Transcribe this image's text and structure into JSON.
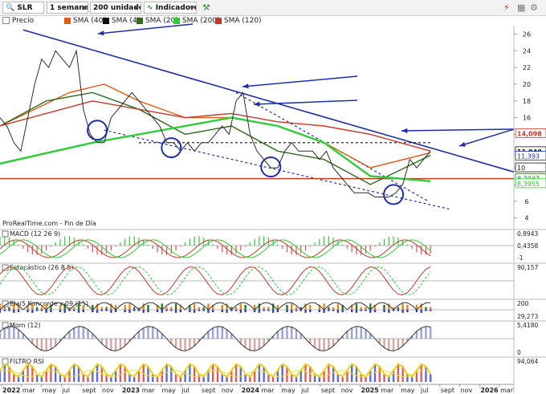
{
  "toolbar": {
    "symbol": "SLR",
    "timeframe": "1 semana",
    "units": "200 unidades",
    "indicators": "Indicadores"
  },
  "legend": [
    {
      "label": "Precio",
      "color": "#ffffff",
      "border": "#888888"
    },
    {
      "label": "SMA (40)",
      "color": "#e05a1a"
    },
    {
      "label": "SMA (4)",
      "color": "#111111"
    },
    {
      "label": "SMA (20)",
      "color": "#2f6b1f"
    },
    {
      "label": "SMA (200)",
      "color": "#2fcc3a"
    },
    {
      "label": "SMA (120)",
      "color": "#c0392b"
    }
  ],
  "attribution": "ProRealTime.com - Fin de Día",
  "colors": {
    "price": "#2a2a2a",
    "sma40": "#e05a1a",
    "sma4": "#111111",
    "sma20": "#2f6b1f",
    "sma200": "#2fcc3a",
    "sma120": "#c0392b",
    "trend": "#1f2ea8",
    "support": "#c0392b"
  },
  "chart_data": [
    {
      "type": "line",
      "panel": "price",
      "title": "",
      "ylim": [
        3,
        27
      ],
      "y_ticks": [
        "26",
        "24",
        "22",
        "20",
        "18",
        "16",
        "14",
        "12",
        "10",
        "8",
        "6",
        "4"
      ],
      "x_ticks": [
        "2022",
        "mar",
        "may",
        "jul",
        "sept",
        "nov",
        "2023",
        "mar",
        "may",
        "jul",
        "sept",
        "nov",
        "2024",
        "mar",
        "may",
        "jul",
        "sept",
        "nov",
        "2025",
        "mar",
        "may",
        "jul",
        "sept",
        "nov",
        "2026",
        "mar"
      ],
      "price_labels": [
        {
          "text": "14,098",
          "value": 14.1,
          "color": "#c0392b",
          "bold": true
        },
        {
          "text": "11,940",
          "value": 11.94,
          "color": "#111111",
          "bold": true
        },
        {
          "text": "11,393",
          "value": 11.39,
          "color": "#1f2ea8"
        },
        {
          "text": "10",
          "value": 10,
          "color": "#111111"
        },
        {
          "text": "8,7037",
          "value": 8.7,
          "color": "#2f6b1f"
        },
        {
          "text": "8,3955",
          "value": 8.1,
          "color": "#2fcc3a"
        }
      ],
      "series": [
        {
          "key": "price",
          "x": [
            0,
            3,
            6,
            9,
            12,
            15,
            18,
            21,
            24,
            27,
            30,
            33,
            36,
            39,
            42,
            45,
            48,
            51,
            54,
            57,
            60,
            63,
            66,
            69,
            72,
            75,
            78,
            81,
            84,
            87,
            90,
            93,
            96,
            99,
            102,
            105,
            108,
            111,
            114,
            117,
            120,
            123,
            126,
            129,
            132,
            135,
            138,
            141,
            144,
            147,
            150,
            153,
            156,
            159,
            162,
            165,
            168,
            171,
            174,
            177,
            180,
            183,
            186
          ],
          "y": [
            16,
            15,
            13,
            12,
            16,
            20,
            23,
            22,
            24,
            23,
            22,
            24,
            17,
            14,
            13,
            13,
            16,
            17,
            18,
            19,
            18,
            17,
            16,
            15,
            13,
            13,
            12,
            13,
            12,
            13,
            13,
            14,
            15,
            14,
            18,
            19,
            14,
            12,
            11,
            10,
            10,
            12,
            13,
            12,
            12,
            12,
            11,
            12,
            10,
            9,
            8,
            7,
            7,
            7,
            6.5,
            6.5,
            6.5,
            7,
            8,
            11,
            10,
            11,
            12
          ]
        },
        {
          "key": "sma40",
          "x": [
            0,
            30,
            45,
            60,
            80,
            100,
            120,
            140,
            160,
            186
          ],
          "y": [
            15,
            19,
            20,
            18,
            16,
            16,
            15,
            13,
            10,
            11.8
          ]
        },
        {
          "key": "sma20",
          "x": [
            0,
            20,
            40,
            60,
            80,
            100,
            120,
            140,
            160,
            186
          ],
          "y": [
            15,
            18,
            19,
            17,
            14,
            15,
            12,
            11,
            8,
            11.5
          ]
        },
        {
          "key": "sma200",
          "x": [
            0,
            40,
            60,
            80,
            100,
            120,
            140,
            160,
            186
          ],
          "y": [
            10.5,
            13,
            14,
            15,
            16,
            15,
            13,
            9,
            8.4
          ]
        },
        {
          "key": "sma120",
          "x": [
            0,
            40,
            60,
            80,
            100,
            120,
            140,
            160,
            186
          ],
          "y": [
            15,
            18,
            17,
            16,
            16.5,
            15.5,
            15,
            14,
            12
          ]
        }
      ],
      "trendlines": [
        {
          "x1": 10,
          "y1": 26.5,
          "x2": 222,
          "y2": 9.5,
          "color": "#1f2ea8"
        },
        {
          "x1": 102,
          "y1": 19,
          "x2": 185,
          "y2": 6,
          "color": "#1f2ea8",
          "dashed": true
        },
        {
          "x1": 45,
          "y1": 14.5,
          "x2": 195,
          "y2": 5,
          "color": "#1f2ea8",
          "dashed": true
        },
        {
          "x1": 60,
          "y1": 13,
          "x2": 186,
          "y2": 13,
          "color": "#111111",
          "dashed": true
        },
        {
          "x1": 0,
          "y1": 8.7,
          "x2": 222,
          "y2": 8.7,
          "color": "#c0392b"
        }
      ],
      "circles": [
        {
          "x": 42,
          "y": 14.5
        },
        {
          "x": 74,
          "y": 12.4
        },
        {
          "x": 117,
          "y": 10.1
        },
        {
          "x": 170,
          "y": 6.8
        }
      ]
    },
    {
      "type": "bar",
      "panel": "macd",
      "title": "MACD (12 26 9)",
      "ylim": [
        -1.2,
        1.2
      ],
      "y_ticks": [
        "0,8943",
        "0,4358",
        "-1"
      ]
    },
    {
      "type": "line",
      "panel": "stoch",
      "title": "Estocástico (26 8 5)",
      "ylim": [
        0,
        100
      ],
      "y_ticks": [
        "90,157"
      ]
    },
    {
      "type": "area",
      "panel": "koncorde",
      "title": "Blai5 Koncorde v.09 (15)",
      "ylim": [
        -100,
        200
      ],
      "y_ticks": [
        "200",
        "29,273"
      ]
    },
    {
      "type": "area",
      "panel": "mom",
      "title": "Mom (12)",
      "ylim": [
        -6,
        8
      ],
      "y_ticks": [
        "5,4180",
        "0"
      ]
    },
    {
      "type": "area",
      "panel": "rsi",
      "title": "FILTRO RSI",
      "ylim": [
        0,
        100
      ],
      "y_ticks": [
        "94,064"
      ]
    }
  ]
}
